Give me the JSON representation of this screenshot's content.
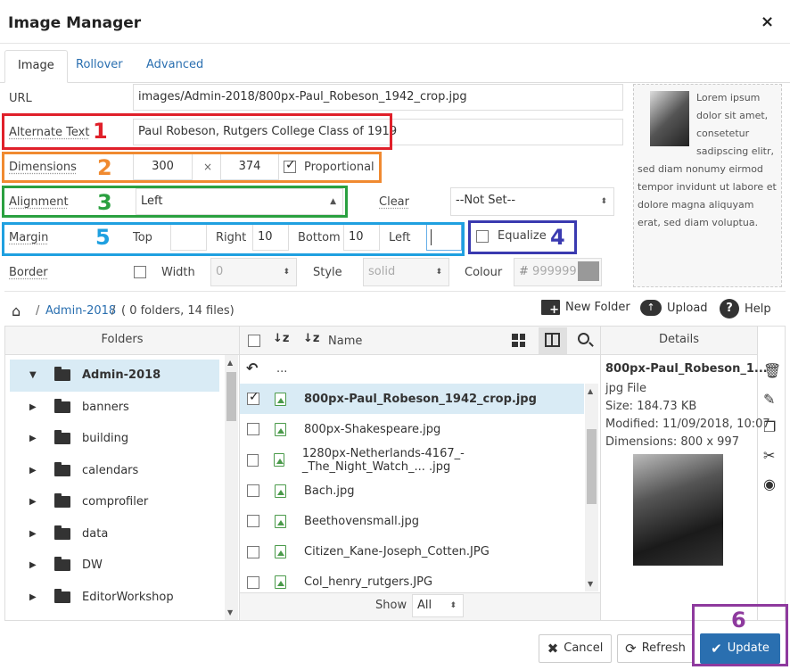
{
  "dialog": {
    "title": "Image Manager",
    "close": "×"
  },
  "tabs": [
    {
      "label": "Image"
    },
    {
      "label": "Rollover"
    },
    {
      "label": "Advanced"
    }
  ],
  "form": {
    "url_label": "URL",
    "url_value": "images/Admin-2018/800px-Paul_Robeson_1942_crop.jpg",
    "alt_label": "Alternate Text",
    "alt_value": "Paul Robeson, Rutgers College Class of 1919",
    "dim_label": "Dimensions",
    "width_value": "300",
    "times": "×",
    "height_value": "374",
    "proportional_label": "Proportional",
    "align_label": "Alignment",
    "align_value": "Left",
    "clear_label": "Clear",
    "clear_value": "--Not Set--",
    "margin_label": "Margin",
    "top_label": "Top",
    "top_value": "",
    "right_label": "Right",
    "right_value": "10",
    "bottom_label": "Bottom",
    "bottom_value": "10",
    "left_label": "Left",
    "left_value": "",
    "equalize_label": "Equalize",
    "border_label": "Border",
    "width_label": "Width",
    "border_width_value": "0",
    "style_label": "Style",
    "style_value": "solid",
    "colour_label": "Colour",
    "colour_hash": "#",
    "colour_value": "999999"
  },
  "preview_text": "Lorem ipsum dolor sit amet, consetetur sadipscing elitr, sed diam nonumy eirmod tempor invidunt ut labore et dolore magna aliquyam erat, sed diam voluptua.",
  "annotations": [
    "1",
    "2",
    "3",
    "4",
    "5",
    "6"
  ],
  "annotation_colors": [
    "#e0202a",
    "#f08a30",
    "#2aa040",
    "#3a3ab0",
    "#1fa0e0",
    "#8e3a9e"
  ],
  "browser": {
    "breadcrumb_root": "Admin-2018",
    "breadcrumb_sep": "/",
    "breadcrumb_info": "( 0 folders, 14 files)",
    "new_folder": "New Folder",
    "upload": "Upload",
    "help": "Help",
    "folders_header": "Folders",
    "name_header": "Name",
    "details_header": "Details",
    "folders": [
      "Admin-2018",
      "banners",
      "building",
      "calendars",
      "comprofiler",
      "data",
      "DW",
      "EditorWorkshop"
    ],
    "parent_dir": "...",
    "files": [
      "800px-Paul_Robeson_1942_crop.jpg",
      "800px-Shakespeare.jpg",
      "1280px-Netherlands-4167_-_The_Night_Watch_... .jpg",
      "Bach.jpg",
      "Beethovensmall.jpg",
      "Citizen_Kane-Joseph_Cotten.JPG",
      "Col_henry_rutgers.JPG"
    ],
    "show_label": "Show",
    "show_value": "All",
    "details": {
      "name": "800px-Paul_Robeson_1...",
      "type": "jpg File",
      "size": "Size: 184.73 KB",
      "modified": "Modified: 11/09/2018, 10:07",
      "dimensions": "Dimensions: 800 x 997"
    }
  },
  "footer": {
    "cancel": "Cancel",
    "refresh": "Refresh",
    "update": "Update"
  }
}
